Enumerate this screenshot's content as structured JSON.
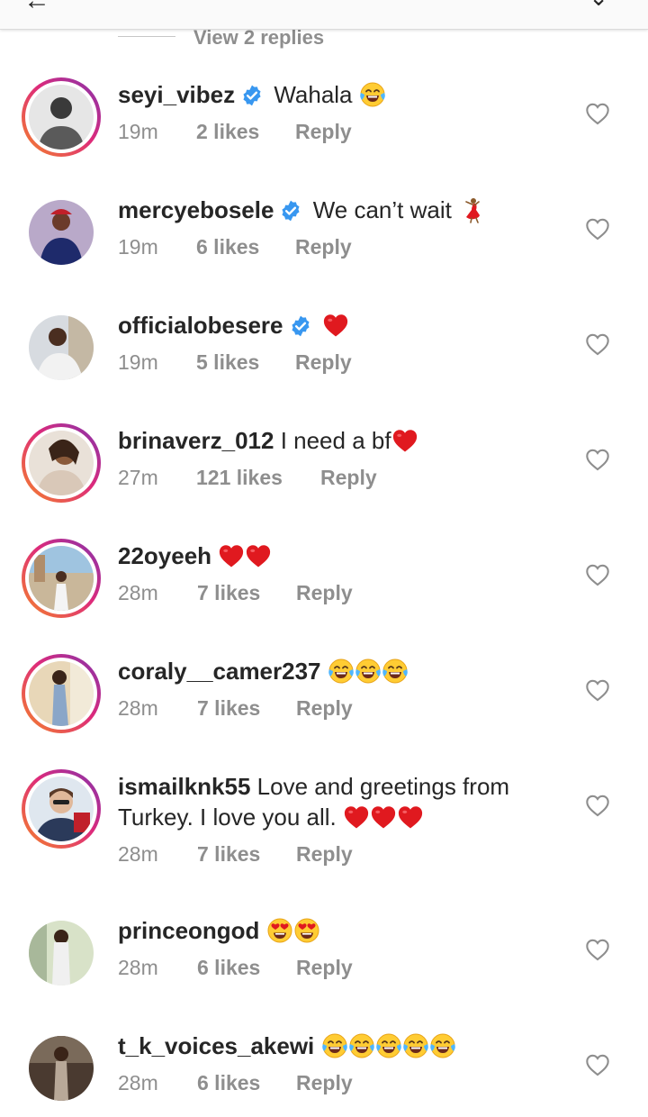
{
  "header": {
    "replies_text": "View 2 replies"
  },
  "colors": {
    "accent_blue": "#3897f0",
    "meta_gray": "#8e8e8e",
    "heart_red": "#e0191f"
  },
  "comments": [
    {
      "username": "seyi_vibez",
      "verified": true,
      "text": "Wahala",
      "emojis": [
        "joy"
      ],
      "time": "19m",
      "likes": "2 likes",
      "reply": "Reply",
      "story_ring": true
    },
    {
      "username": "mercyebosele",
      "verified": true,
      "text": "We can’t wait",
      "emojis": [
        "dancer"
      ],
      "time": "19m",
      "likes": "6 likes",
      "reply": "Reply",
      "story_ring": false
    },
    {
      "username": "officialobesere",
      "verified": true,
      "text": "",
      "emojis": [
        "red-heart"
      ],
      "time": "19m",
      "likes": "5 likes",
      "reply": "Reply",
      "story_ring": false
    },
    {
      "username": "brinaverz_012",
      "verified": false,
      "text": "I need a bf",
      "emojis": [
        "red-heart"
      ],
      "time": "27m",
      "likes": "121 likes",
      "reply": "Reply",
      "story_ring": true
    },
    {
      "username": "22oyeeh",
      "verified": false,
      "text": "",
      "emojis": [
        "red-heart",
        "red-heart"
      ],
      "time": "28m",
      "likes": "7 likes",
      "reply": "Reply",
      "story_ring": true
    },
    {
      "username": "coraly__camer237",
      "verified": false,
      "text": "",
      "emojis": [
        "joy",
        "joy",
        "joy"
      ],
      "time": "28m",
      "likes": "7 likes",
      "reply": "Reply",
      "story_ring": true
    },
    {
      "username": "ismailknk55",
      "verified": false,
      "text": "Love and greetings from",
      "text2": "Turkey. I love you all.",
      "emojis": [
        "red-heart",
        "red-heart",
        "red-heart"
      ],
      "time": "28m",
      "likes": "7 likes",
      "reply": "Reply",
      "story_ring": true
    },
    {
      "username": "princeongod",
      "verified": false,
      "text": "",
      "emojis": [
        "heart-eyes",
        "heart-eyes"
      ],
      "time": "28m",
      "likes": "6 likes",
      "reply": "Reply",
      "story_ring": false
    },
    {
      "username": "t_k_voices_akewi",
      "verified": false,
      "text": "",
      "emojis": [
        "joy",
        "joy",
        "joy",
        "joy",
        "joy"
      ],
      "time": "28m",
      "likes": "6 likes",
      "reply": "Reply",
      "story_ring": false
    }
  ]
}
